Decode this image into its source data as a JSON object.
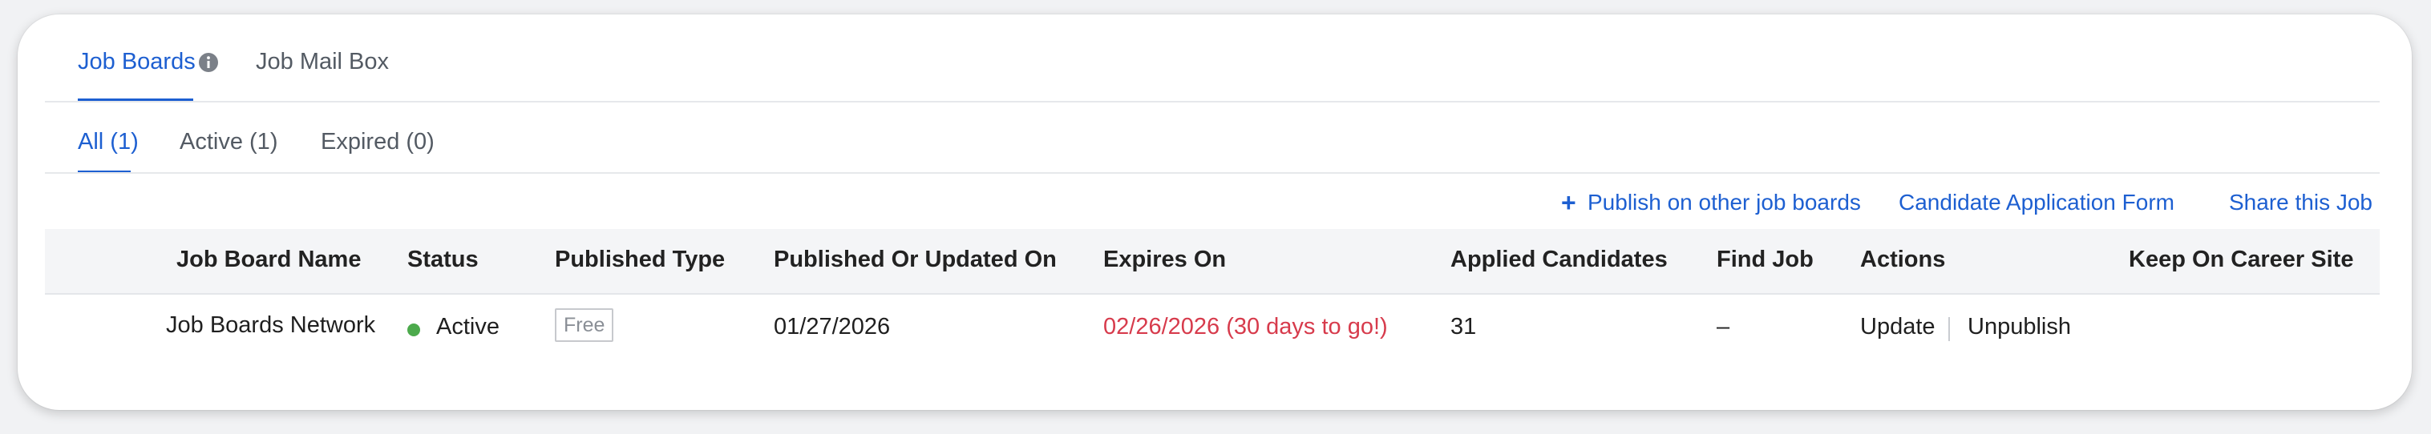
{
  "tabs": [
    {
      "label": "Job Boards",
      "active": true
    },
    {
      "label": "Job Mail Box",
      "active": false
    }
  ],
  "subtabs": [
    {
      "label": "All (1)",
      "active": true
    },
    {
      "label": "Active (1)",
      "active": false
    },
    {
      "label": "Expired (0)",
      "active": false
    }
  ],
  "actions": {
    "publish_plus": "+",
    "publish": "Publish on other job boards",
    "application_form": "Candidate Application Form",
    "share": "Share this Job"
  },
  "table": {
    "headers": [
      "Job Board Name",
      "Status",
      "Published Type",
      "Published Or Updated On",
      "Expires On",
      "Applied Candidates",
      "Find Job",
      "Actions",
      "Keep On Career Site"
    ],
    "rows": [
      {
        "job_board_name": "Job Boards Network",
        "status": "Active",
        "published_type": "Free",
        "published_on": "01/27/2026",
        "expires_on": "02/26/2026 (30 days to go!)",
        "applied_candidates": "31",
        "find_job": "–",
        "action_update": "Update",
        "action_unpublish": "Unpublish"
      }
    ]
  },
  "colors": {
    "accent": "#1d5fd1",
    "expiry": "#d73b4c",
    "status_active": "#4caa4c"
  },
  "icons": {
    "tab_info": "info-icon",
    "publish": "plus-icon",
    "status": "status-dot"
  }
}
